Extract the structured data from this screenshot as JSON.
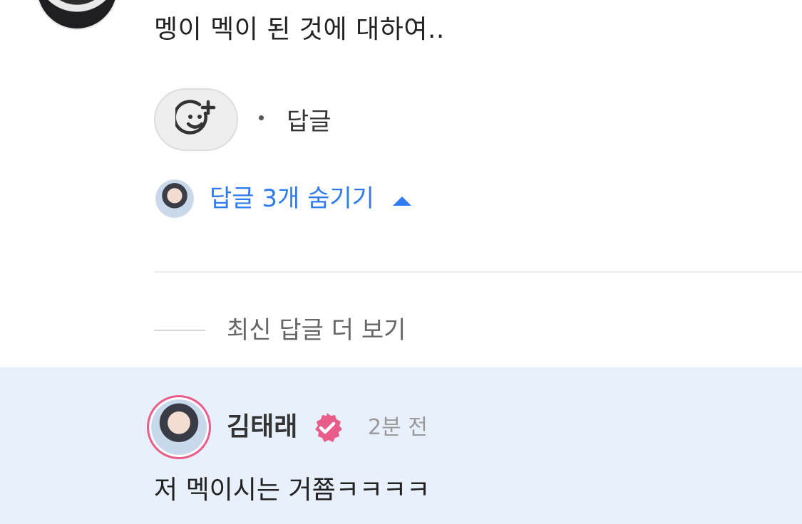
{
  "comment": {
    "text": "멩이 멕이 된 것에 대하여..",
    "reply_link": "답글",
    "hide_replies": "답글 3개 숨기기",
    "reaction_icon": "smiley-plus-icon",
    "collapse_icon": "caret-up-icon"
  },
  "more_replies": {
    "label": "최신 답글 더 보기"
  },
  "reply": {
    "author": "김태래",
    "verified_icon": "verified-badge-icon",
    "time": "2분 전",
    "text": "저 멕이시는 거쬼ㅋㅋㅋㅋ"
  },
  "colors": {
    "accent": "#2f7bf0",
    "highlight_bg": "#e7f0fb",
    "badge": "#e85d8a"
  }
}
